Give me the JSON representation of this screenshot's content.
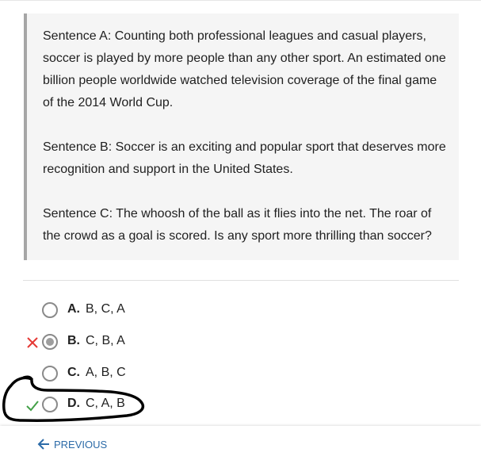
{
  "passage": {
    "sentence_a": "Sentence A: Counting both professional leagues and casual players, soccer is played by more people than any other sport. An estimated one billion people worldwide watched television coverage of the final game of the 2014 World Cup.",
    "sentence_b": "Sentence B: Soccer is an exciting and popular sport that deserves more recognition and support in the United States.",
    "sentence_c": "Sentence C: The whoosh of the ball as it flies into the net. The roar of the crowd as a goal is scored. Is any sport more thrilling than soccer?"
  },
  "options": [
    {
      "letter": "A.",
      "text": "B, C, A",
      "selected": false,
      "status": "none"
    },
    {
      "letter": "B.",
      "text": "C, B, A",
      "selected": true,
      "status": "incorrect"
    },
    {
      "letter": "C.",
      "text": "A, B, C",
      "selected": false,
      "status": "none"
    },
    {
      "letter": "D.",
      "text": "C, A, B",
      "selected": false,
      "status": "correct"
    }
  ],
  "footer": {
    "previous_label": "PREVIOUS"
  },
  "colors": {
    "incorrect": "#e53935",
    "correct": "#43a047",
    "link": "#2c6ba8"
  }
}
